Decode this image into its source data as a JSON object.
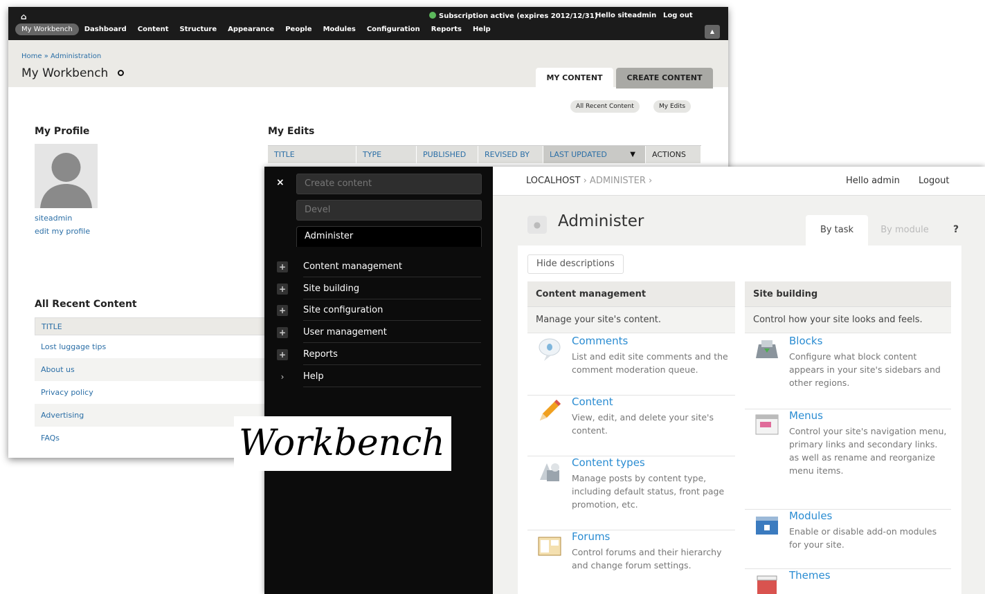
{
  "workbench": {
    "toolbar": {
      "nav": [
        "My Workbench",
        "Dashboard",
        "Content",
        "Structure",
        "Appearance",
        "People",
        "Modules",
        "Configuration",
        "Reports",
        "Help"
      ],
      "subscription": "Subscription active (expires 2012/12/31)",
      "hello": "Hello",
      "user": "siteadmin",
      "logout": "Log out"
    },
    "breadcrumb": "Home » Administration",
    "title": "My Workbench",
    "tabs": [
      "MY CONTENT",
      "CREATE CONTENT"
    ],
    "pills": [
      "All Recent Content",
      "My Edits"
    ],
    "profile": {
      "heading": "My Profile",
      "username": "siteadmin",
      "edit_link": "edit my profile"
    },
    "my_edits": {
      "heading": "My Edits",
      "columns": [
        "TITLE",
        "TYPE",
        "PUBLISHED",
        "REVISED BY",
        "LAST UPDATED",
        "ACTIONS"
      ]
    },
    "recent": {
      "heading": "All Recent Content",
      "column": "TITLE",
      "rows": [
        "Lost luggage tips",
        "About us",
        "Privacy policy",
        "Advertising",
        "FAQs"
      ]
    }
  },
  "admin": {
    "sidebar": {
      "close": "×",
      "buttons": [
        "Create content",
        "Devel"
      ],
      "active": "Administer",
      "items": [
        {
          "label": "Content management",
          "icon": "plus-icon"
        },
        {
          "label": "Site building",
          "icon": "plus-icon"
        },
        {
          "label": "Site configuration",
          "icon": "plus-icon"
        },
        {
          "label": "User management",
          "icon": "plus-icon"
        },
        {
          "label": "Reports",
          "icon": "plus-icon"
        },
        {
          "label": "Help",
          "icon": "chevron-right-icon"
        }
      ]
    },
    "breadcrumb": {
      "first": "LOCALHOST",
      "sep": "›",
      "second": "ADMINISTER"
    },
    "hello": "Hello admin",
    "logout": "Logout",
    "title": "Administer",
    "tabs": [
      "By task",
      "By module"
    ],
    "help": "?",
    "hide_descriptions": "Hide descriptions",
    "columns": [
      {
        "heading": "Content management",
        "desc": "Manage your site's content.",
        "items": [
          {
            "title": "Comments",
            "desc": "List and edit site comments and the comment moderation queue.",
            "icon": "comment-icon"
          },
          {
            "title": "Content",
            "desc": "View, edit, and delete your site's content.",
            "icon": "pencil-icon"
          },
          {
            "title": "Content types",
            "desc": "Manage posts by content type, including default status, front page promotion, etc.",
            "icon": "shapes-icon"
          },
          {
            "title": "Forums",
            "desc": "Control forums and their hierarchy and change forum settings.",
            "icon": "forum-icon"
          }
        ]
      },
      {
        "heading": "Site building",
        "desc": "Control how your site looks and feels.",
        "items": [
          {
            "title": "Blocks",
            "desc": "Configure what block content appears in your site's sidebars and other regions.",
            "icon": "blocks-icon"
          },
          {
            "title": "Menus",
            "desc": "Control your site's navigation menu, primary links and secondary links. as well as rename and reorganize menu items.",
            "icon": "menu-icon"
          },
          {
            "title": "Modules",
            "desc": "Enable or disable add-on modules for your site.",
            "icon": "modules-icon"
          },
          {
            "title": "Themes",
            "desc": "",
            "icon": "themes-icon"
          }
        ]
      }
    ]
  },
  "caption": "Workbench"
}
